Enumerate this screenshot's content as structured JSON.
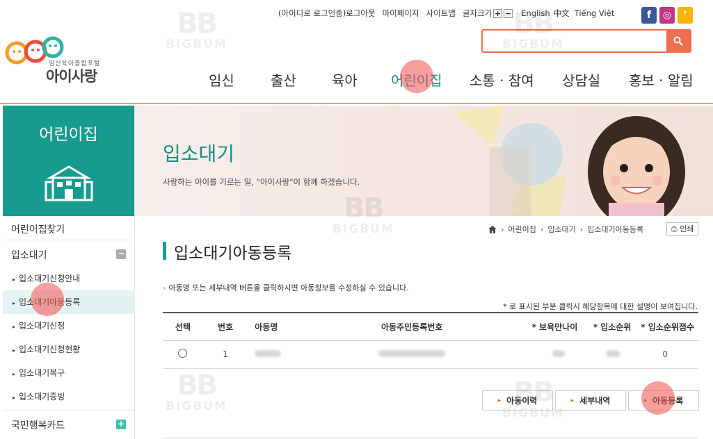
{
  "header": {
    "logo_sub": "임신육아종합포털",
    "logo_name": "아이사랑",
    "util": {
      "login": "(아이디로 로그인중)로그아웃",
      "mypage": "마이페이지",
      "sitemap": "사이트맵",
      "fontsize": "글자크기",
      "plus": "+",
      "minus": "−",
      "english": "English",
      "chinese": "中文",
      "vietnamese": "Tiếng Việt"
    },
    "sns": {
      "facebook": "f",
      "instagram": "◎",
      "kakao": "❜"
    },
    "search": {
      "value": "",
      "placeholder": ""
    },
    "gnb": [
      "임신",
      "출산",
      "육아",
      "어린이집",
      "소통 · 참여",
      "상담실",
      "홍보 · 알림"
    ],
    "gnb_active": "어린이집"
  },
  "lnb": {
    "title": "어린이집",
    "find": "어린이집찾기",
    "section": "입소대기",
    "items": [
      "입소대기신청안내",
      "입소대기아동등록",
      "입소대기신청",
      "입소대기신청현황",
      "입소대기복구",
      "입소대기증빙"
    ],
    "active_item": "입소대기아동등록",
    "card": "국민행복카드"
  },
  "banner": {
    "title": "입소대기",
    "subtitle": "사랑하는 아이를 기르는 일, \"아이사랑\"이 함께 하겠습니다."
  },
  "breadcrumb": {
    "c1": "어린이집",
    "c2": "입소대기",
    "c3": "입소대기아동등록",
    "print": "인쇄"
  },
  "content": {
    "title": "입소대기아동등록",
    "notice": "아동명 또는 세부내역 버튼을 클릭하시면 아동정보를 수정하실 수 있습니다.",
    "table_note": "* 로 표시된 부분 클릭시 해당항목에 대한 설명이 보여집니다.",
    "columns": [
      "선택",
      "번호",
      "아동명",
      "아동주민등록번호",
      "* 보육만나이",
      "* 입소순위",
      "* 입소순위점수"
    ],
    "rows": [
      {
        "no": "1",
        "score": "0"
      }
    ],
    "buttons": {
      "history": "아동이력",
      "detail": "세부내역",
      "register": "아동등록"
    }
  },
  "watermark": {
    "big": "BB",
    "text": "BIGBUM"
  },
  "colors": {
    "accent": "#179b8f",
    "orange": "#ec6f4f",
    "highlight_spot": "#f05050"
  }
}
